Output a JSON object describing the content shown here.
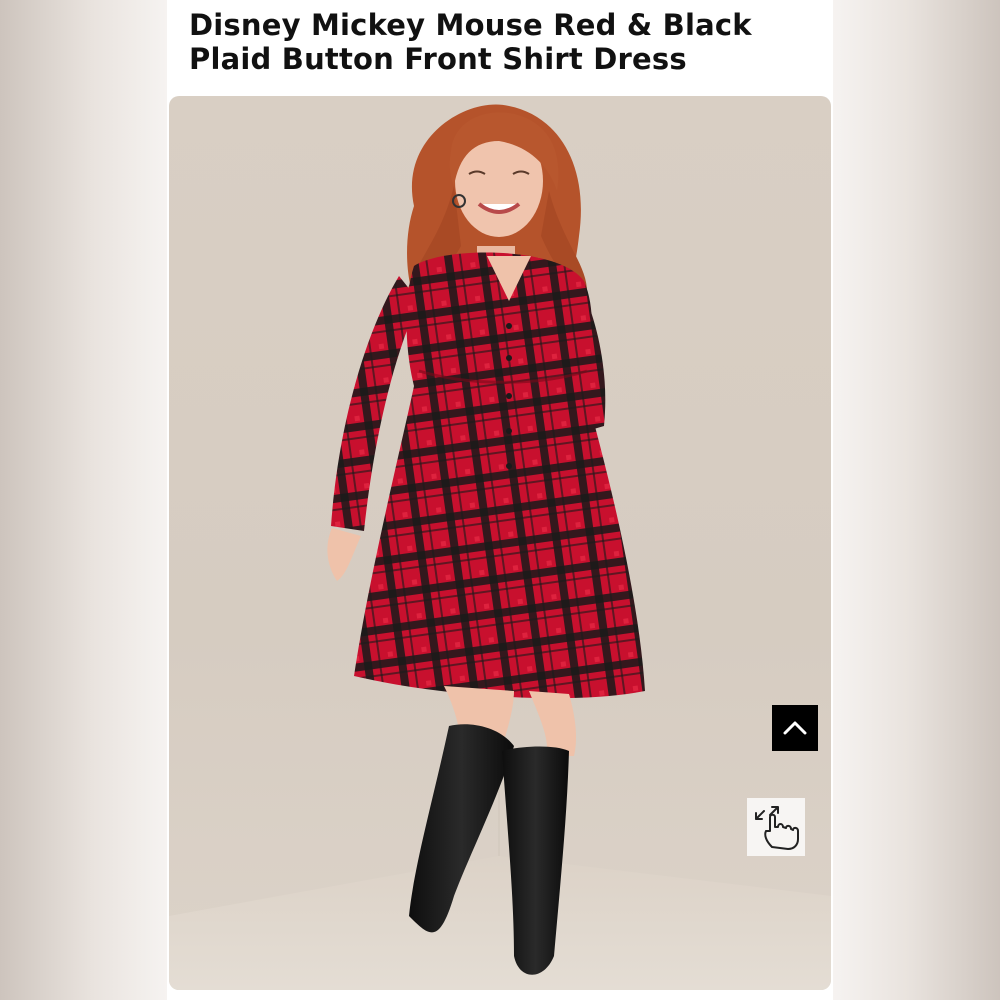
{
  "product": {
    "title": "Disney Mickey Mouse Red & Black Plaid Button Front Shirt Dress"
  },
  "photo": {
    "icon": "product-photo",
    "colors": {
      "plaid_red": "#c8102e",
      "plaid_black": "#1a1a1a",
      "backdrop": "#d9cfc4"
    }
  },
  "controls": {
    "scroll_top_icon": "chevron-up-icon",
    "zoom_icon": "pinch-zoom-hand-icon"
  }
}
